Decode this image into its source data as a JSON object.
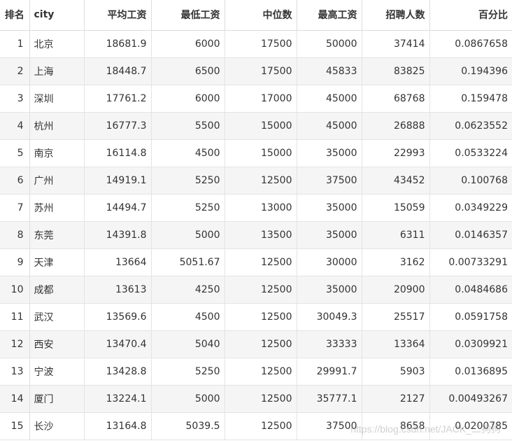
{
  "table": {
    "headers": [
      "排名",
      "city",
      "平均工资",
      "最低工资",
      "中位数",
      "最高工资",
      "招聘人数",
      "百分比"
    ],
    "rows": [
      [
        "1",
        "北京",
        "18681.9",
        "6000",
        "17500",
        "50000",
        "37414",
        "0.0867658"
      ],
      [
        "2",
        "上海",
        "18448.7",
        "6500",
        "17500",
        "45833",
        "83825",
        "0.194396"
      ],
      [
        "3",
        "深圳",
        "17761.2",
        "6000",
        "17000",
        "45000",
        "68768",
        "0.159478"
      ],
      [
        "4",
        "杭州",
        "16777.3",
        "5500",
        "15000",
        "45000",
        "26888",
        "0.0623552"
      ],
      [
        "5",
        "南京",
        "16114.8",
        "4500",
        "15000",
        "35000",
        "22993",
        "0.0533224"
      ],
      [
        "6",
        "广州",
        "14919.1",
        "5250",
        "12500",
        "37500",
        "43452",
        "0.100768"
      ],
      [
        "7",
        "苏州",
        "14494.7",
        "5250",
        "13000",
        "35000",
        "15059",
        "0.0349229"
      ],
      [
        "8",
        "东莞",
        "14391.8",
        "5000",
        "13500",
        "35000",
        "6311",
        "0.0146357"
      ],
      [
        "9",
        "天津",
        "13664",
        "5051.67",
        "12500",
        "30000",
        "3162",
        "0.00733291"
      ],
      [
        "10",
        "成都",
        "13613",
        "4250",
        "12500",
        "35000",
        "20900",
        "0.0484686"
      ],
      [
        "11",
        "武汉",
        "13569.6",
        "4500",
        "12500",
        "30049.3",
        "25517",
        "0.0591758"
      ],
      [
        "12",
        "西安",
        "13470.4",
        "5040",
        "12500",
        "33333",
        "13364",
        "0.0309921"
      ],
      [
        "13",
        "宁波",
        "13428.8",
        "5250",
        "12500",
        "29991.7",
        "5903",
        "0.0136895"
      ],
      [
        "14",
        "厦门",
        "13224.1",
        "5000",
        "12500",
        "35777.1",
        "2127",
        "0.00493267"
      ],
      [
        "15",
        "长沙",
        "13164.8",
        "5039.5",
        "12500",
        "37500",
        "8658",
        "0.0200785"
      ]
    ]
  },
  "watermark": {
    "text": "https://blog.csdn.net/JACK_二狗狗"
  }
}
